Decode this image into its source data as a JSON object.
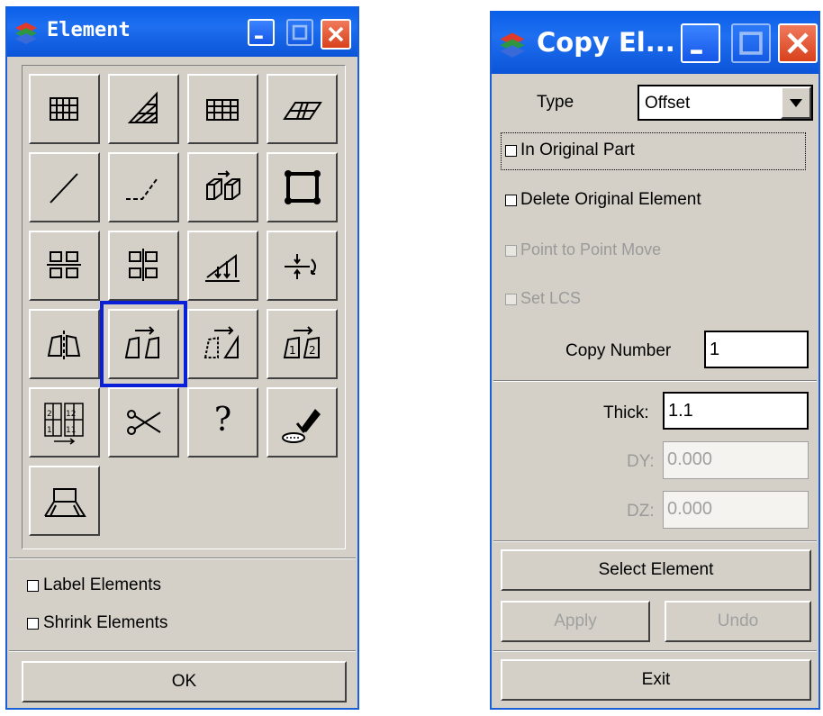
{
  "element_window": {
    "title": "Element",
    "tool_buttons": [
      [
        "mesh-grid",
        "triangle-mesh",
        "quad-grid",
        "plane-mesh"
      ],
      [
        "line-solid",
        "line-dashed",
        "copy-solid",
        "rectangle-element"
      ],
      [
        "align-grid-a",
        "align-grid-b",
        "offset-project",
        "split-arrow"
      ],
      [
        "mirror",
        "copy-element",
        "move-element",
        "renumber"
      ],
      [
        "number-grid",
        "scissors",
        "help",
        "erase"
      ],
      [
        "tetra-element"
      ]
    ],
    "selected_tool": "copy-element",
    "label_elements": "Label Elements",
    "shrink_elements": "Shrink Elements",
    "ok_label": "OK",
    "help_symbol": "?"
  },
  "copy_window": {
    "title": "Copy El...",
    "type_label": "Type",
    "type_value": "Offset",
    "in_original_part": "In Original Part",
    "delete_original": "Delete Original Element",
    "point_to_point": "Point to Point Move",
    "set_lcs": "Set LCS",
    "copy_number_label": "Copy Number",
    "copy_number_value": "1",
    "thick_label": "Thick:",
    "thick_value": "1.1",
    "dy_label": "DY:",
    "dy_value": "0.000",
    "dz_label": "DZ:",
    "dz_value": "0.000",
    "select_element": "Select Element",
    "apply": "Apply",
    "undo": "Undo",
    "exit": "Exit"
  },
  "colors": {
    "title_bar": "#0b5ae6",
    "selection": "#0a20d8",
    "window_face": "#d4d0c8"
  }
}
